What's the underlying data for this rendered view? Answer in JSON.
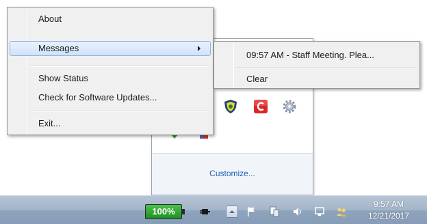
{
  "context_menu": {
    "items": [
      {
        "label": "About"
      },
      {
        "label": "Messages",
        "has_submenu": true,
        "highlighted": true
      },
      {
        "label": "Show Status"
      },
      {
        "label": "Check for Software Updates..."
      },
      {
        "label": "Exit..."
      }
    ]
  },
  "submenu": {
    "items": [
      {
        "label": "09:57 AM - Staff Meeting. Plea..."
      },
      {
        "label": "Clear"
      }
    ]
  },
  "tray_flyout": {
    "customize_label": "Customize...",
    "icons": [
      "shield-icon",
      "red-c-icon",
      "gear-icon",
      "green-app-icon",
      "red-app-icon"
    ]
  },
  "taskbar": {
    "battery_label": "100%",
    "clock_time": "9:57 AM",
    "clock_date": "12/21/2017",
    "tray_icons": [
      "plug-icon",
      "show-hidden-icons-icon",
      "flag-icon",
      "network-device-icon",
      "volume-icon",
      "display-icon",
      "users-icon"
    ]
  },
  "colors": {
    "menu_background": "#f0f0f0",
    "highlight": "#cfe3f9",
    "taskbar": "#8ea3bc",
    "link": "#1f5fae",
    "battery_green": "#2aa530"
  }
}
